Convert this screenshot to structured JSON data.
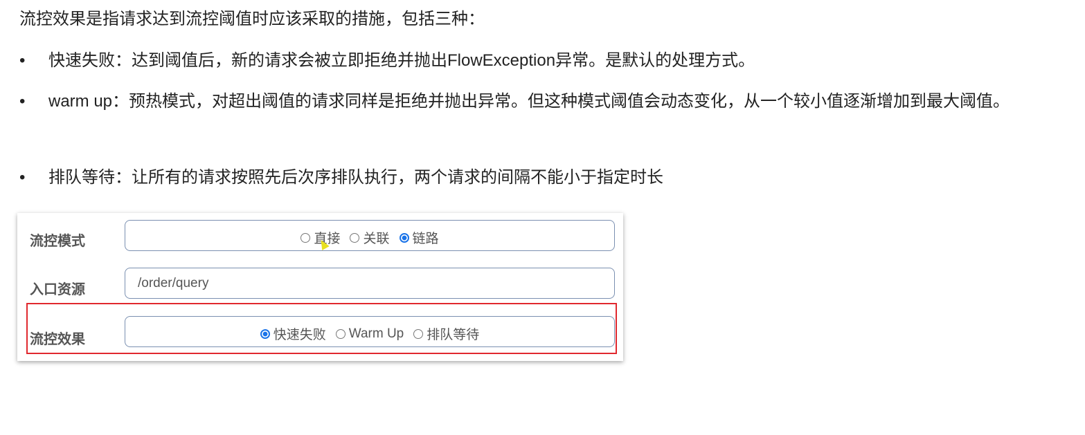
{
  "intro": "流控效果是指请求达到流控阈值时应该采取的措施，包括三种：",
  "bullets": [
    "快速失败：达到阈值后，新的请求会被立即拒绝并抛出FlowException异常。是默认的处理方式。",
    "warm up：预热模式，对超出阈值的请求同样是拒绝并抛出异常。但这种模式阈值会动态变化，从一个较小值逐渐增加到最大阈值。",
    "排队等待：让所有的请求按照先后次序排队执行，两个请求的间隔不能小于指定时长"
  ],
  "bullet_char": "•",
  "form": {
    "mode": {
      "label": "流控模式",
      "options": [
        "直接",
        "关联",
        "链路"
      ],
      "selected": "链路"
    },
    "entry": {
      "label": "入口资源",
      "value": "/order/query"
    },
    "effect": {
      "label": "流控效果",
      "options": [
        "快速失败",
        "Warm Up",
        "排队等待"
      ],
      "selected": "快速失败"
    }
  },
  "colors": {
    "highlight": "#e0282e",
    "radio_selected": "#1a73e8"
  }
}
